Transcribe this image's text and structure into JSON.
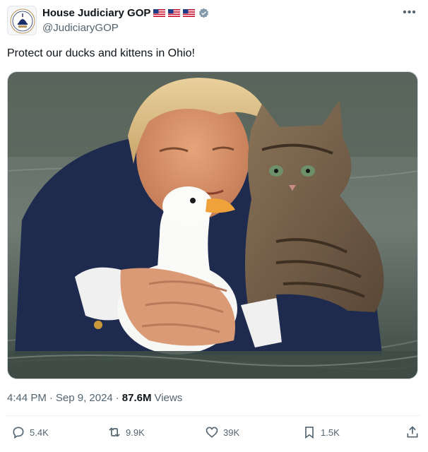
{
  "author": {
    "display_name": "House Judiciary GOP",
    "handle": "@JudiciaryGOP",
    "avatar_icon": "capitol-dome-seal-icon",
    "flag_icon": "us-flag-icon",
    "verified_icon": "verified-gray-badge-icon"
  },
  "tweet": {
    "text": "Protect our ducks and kittens in Ohio!",
    "time": "4:44 PM",
    "sep1": "·",
    "date": "Sep 9, 2024",
    "sep2": "·",
    "views_count": "87.6M",
    "views_label": "Views"
  },
  "actions": {
    "replies": "5.4K",
    "reposts": "9.9K",
    "likes": "39K",
    "bookmarks": "1.5K"
  },
  "colors": {
    "text": "#0f1419",
    "secondary": "#536471",
    "border": "#cfd9de"
  }
}
